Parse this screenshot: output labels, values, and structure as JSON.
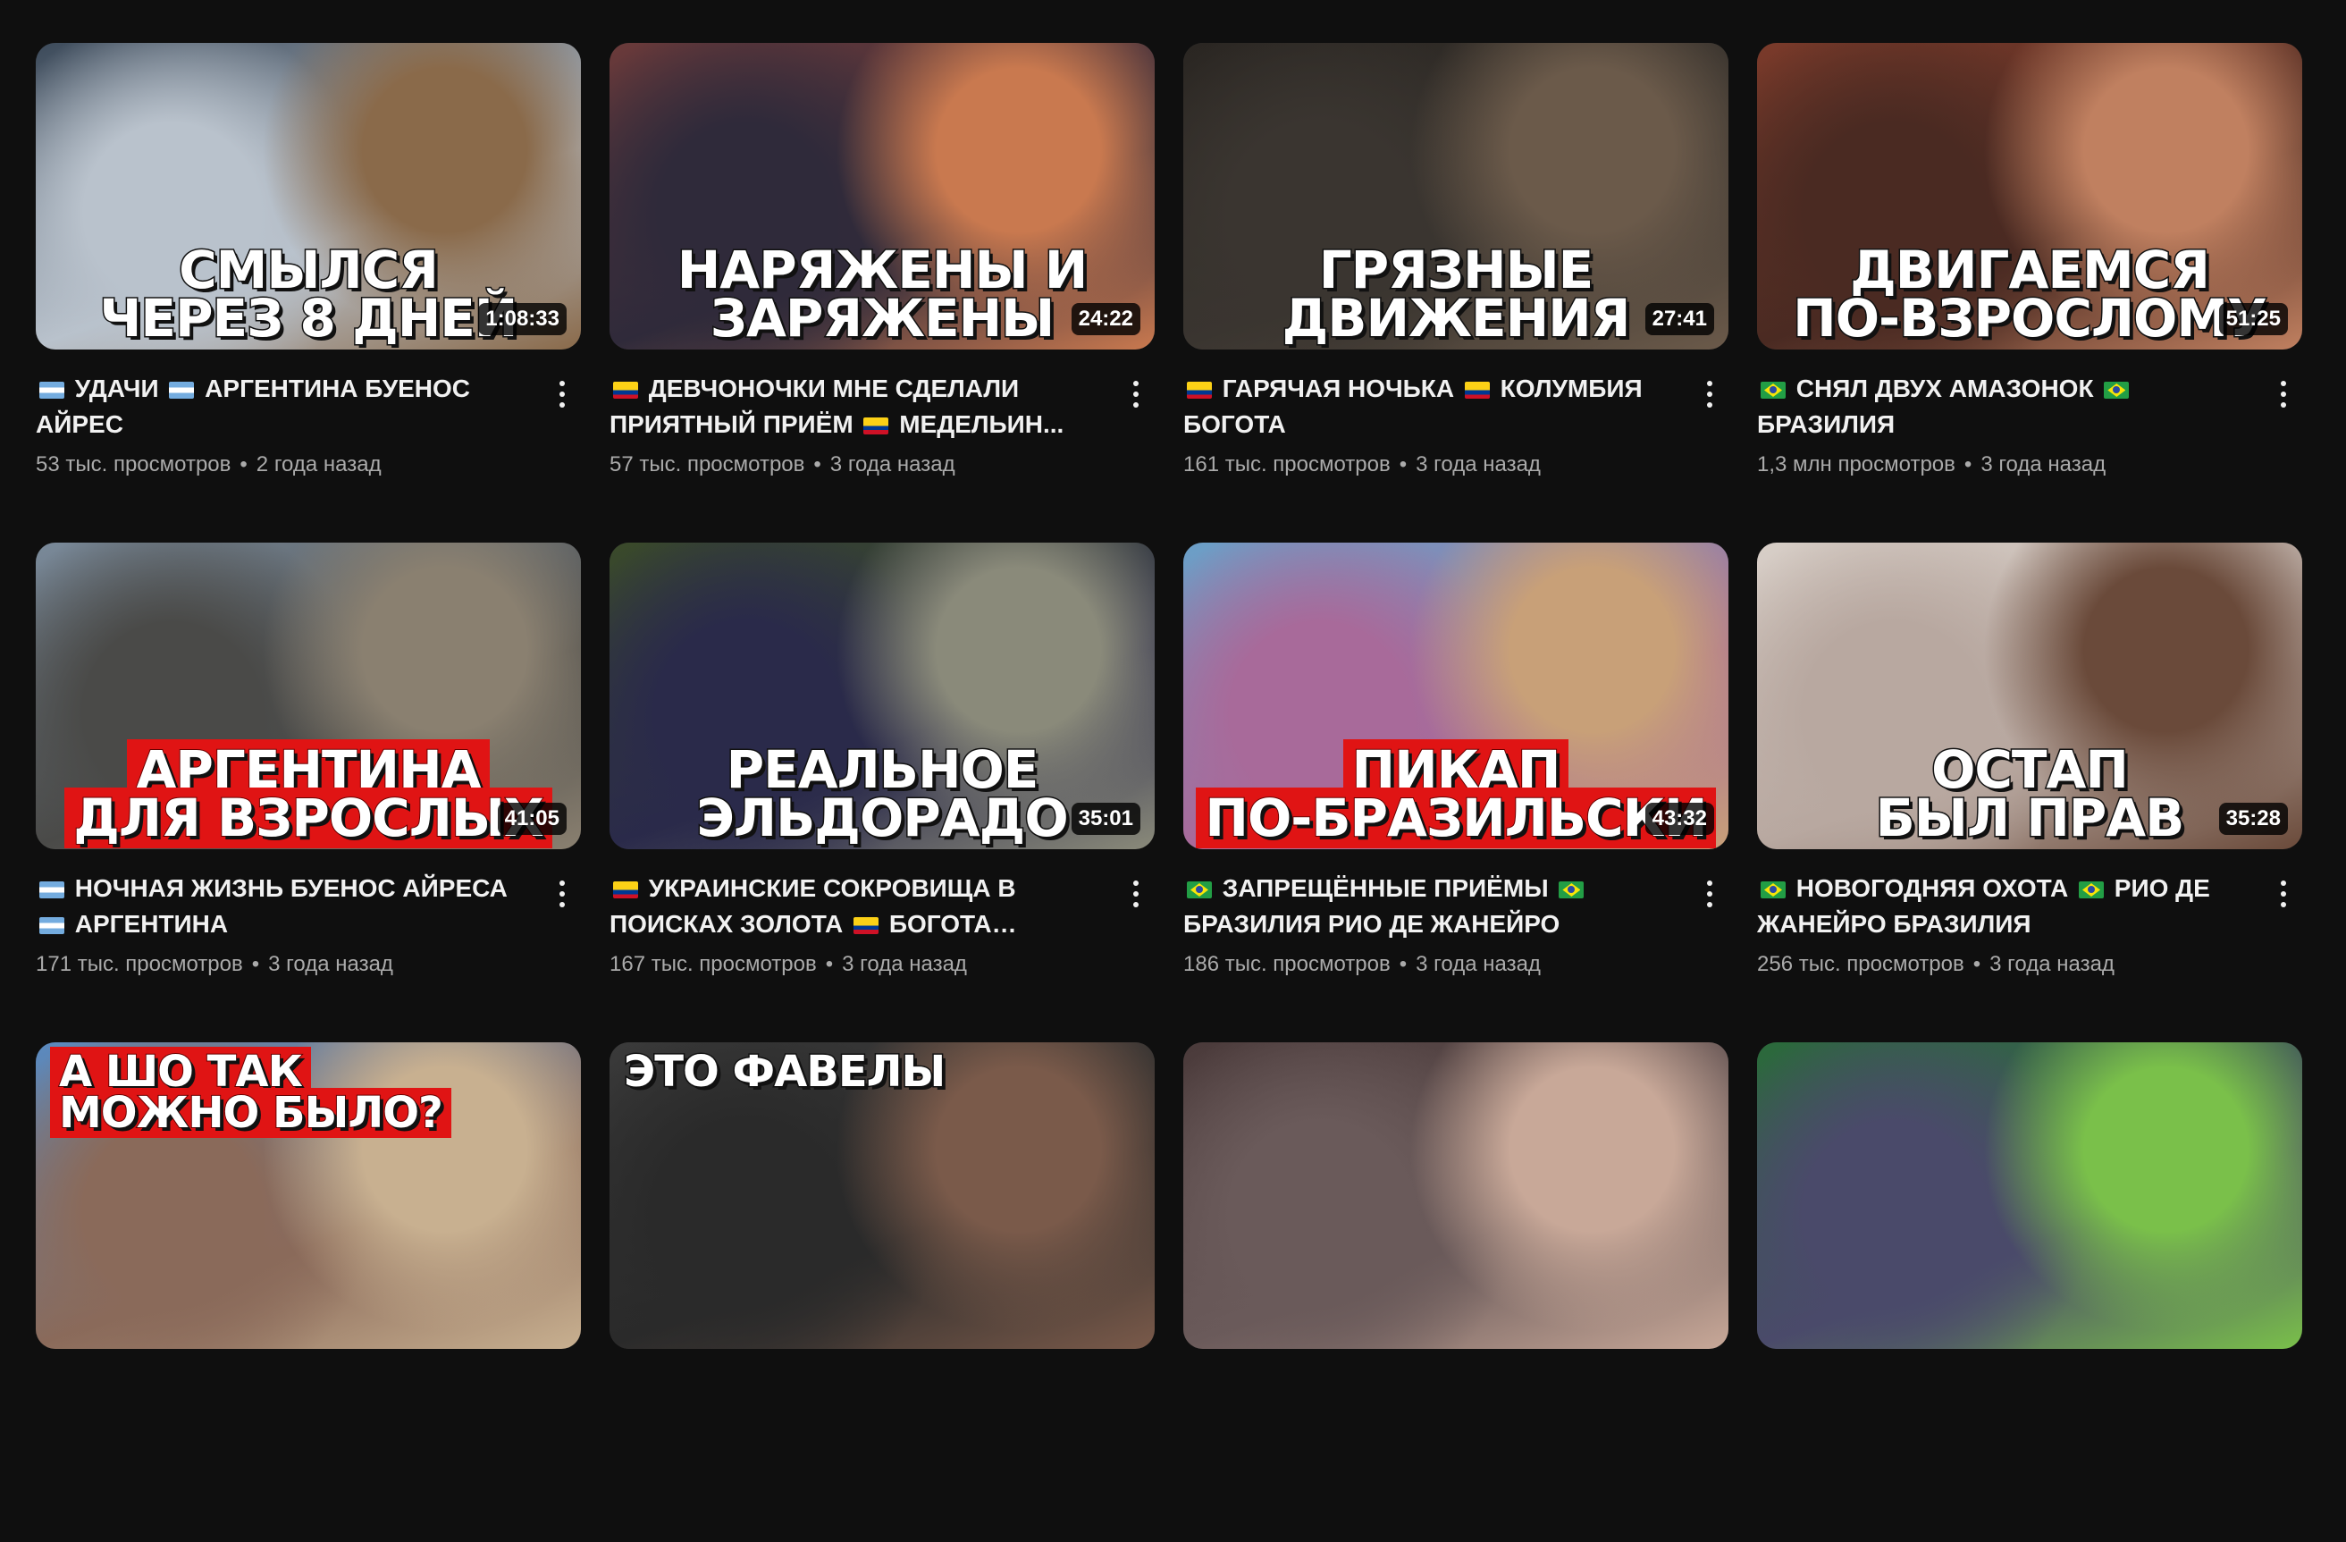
{
  "videos": [
    {
      "overlay": [
        "СМЫЛСЯ",
        "ЧЕРЕЗ 8 ДНЕЙ"
      ],
      "duration": "1:08:33",
      "flag": "ar",
      "title_a": "УДАЧИ",
      "title_b": "АРГЕНТИНА БУЕНОС АЙРЕС",
      "views": "53 тыс. просмотров",
      "age": "2 года назад",
      "colors": [
        "#3c4a5a",
        "#8a6a4a",
        "#b9c2cc"
      ]
    },
    {
      "overlay": [
        "НАРЯЖЕНЫ И",
        "ЗАРЯЖЕНЫ"
      ],
      "duration": "24:22",
      "flag": "co",
      "title_a": "ДЕВЧОНОЧКИ МНЕ СДЕЛАЛИ ПРИЯТНЫЙ ПРИЁМ",
      "title_b": "МЕДЕЛЬИН...",
      "views": "57 тыс. просмотров",
      "age": "3 года назад",
      "colors": [
        "#6a3a3a",
        "#c9794f",
        "#2f2a3a"
      ]
    },
    {
      "overlay": [
        "ГРЯЗНЫЕ",
        "ДВИЖЕНИЯ"
      ],
      "duration": "27:41",
      "flag": "co",
      "title_a": "ГАРЯЧАЯ НОЧЬКА",
      "title_b": "КОЛУМБИЯ БОГОТА",
      "views": "161 тыс. просмотров",
      "age": "3 года назад",
      "colors": [
        "#2a2622",
        "#6b5a4a",
        "#3a3530"
      ]
    },
    {
      "overlay": [
        "ДВИГАЕМСЯ",
        "ПО-ВЗРОСЛОМУ"
      ],
      "duration": "51:25",
      "flag": "br",
      "title_a": "СНЯЛ ДВУХ АМАЗОНОК",
      "title_b": "БРАЗИЛИЯ",
      "views": "1,3 млн просмотров",
      "age": "3 года назад",
      "colors": [
        "#7a3a2a",
        "#c08060",
        "#4a2a22"
      ]
    },
    {
      "overlay": [
        "АРГЕНТИНА",
        "ДЛЯ ВЗРОСЛЫХ"
      ],
      "duration": "41:05",
      "flag": "ar",
      "title_a": "НОЧНАЯ ЖИЗНЬ БУЕНОС АЙРЕСА",
      "title_b": "АРГЕНТИНА",
      "views": "171 тыс. просмотров",
      "age": "3 года назад",
      "colors": [
        "#7a8a9a",
        "#8a8070",
        "#4a4a48"
      ]
    },
    {
      "overlay": [
        "РЕАЛЬНОЕ",
        "ЭЛЬДОРАДО"
      ],
      "duration": "35:01",
      "flag": "co",
      "title_a": "УКРАИНСКИЕ СОКРОВИЩА В ПОИСКАХ ЗОЛОТА",
      "title_b": "БОГОТА КОЛУМБИЯ",
      "views": "167 тыс. просмотров",
      "age": "3 года назад",
      "colors": [
        "#3a4a2a",
        "#8a8a7a",
        "#2a2a4a"
      ]
    },
    {
      "overlay": [
        "ПИКАП",
        "ПО-БРАЗИЛЬСКИ"
      ],
      "duration": "43:32",
      "flag": "br",
      "title_a": "ЗАПРЕЩЁННЫЕ ПРИЁМЫ",
      "title_b": "БРАЗИЛИЯ РИО ДЕ ЖАНЕЙРО",
      "views": "186 тыс. просмотров",
      "age": "3 года назад",
      "colors": [
        "#6aa0c8",
        "#c8a078",
        "#a86a9a"
      ]
    },
    {
      "overlay": [
        "ОСТАП",
        "БЫЛ ПРАВ"
      ],
      "duration": "35:28",
      "flag": "br",
      "title_a": "НОВОГОДНЯЯ ОХОТА",
      "title_b": "РИО ДЕ ЖАНЕЙРО БРАЗИЛИЯ",
      "views": "256 тыс. просмотров",
      "age": "3 года назад",
      "colors": [
        "#d8cfc8",
        "#6a4a3a",
        "#b8a8a0"
      ]
    },
    {
      "overlay": [
        "А ШО ТАК",
        "МОЖНО БЫЛО?"
      ],
      "duration": "",
      "flag": "",
      "title_a": "",
      "title_b": "",
      "views": "",
      "age": "",
      "colors": [
        "#5a8ac0",
        "#c8b090",
        "#8a6a5a"
      ]
    },
    {
      "overlay": [
        "",
        "ЭТО ФАВЕЛЫ"
      ],
      "duration": "",
      "flag": "",
      "title_a": "",
      "title_b": "",
      "views": "",
      "age": "",
      "colors": [
        "#3a3a3a",
        "#7a5a4a",
        "#2a2a2a"
      ]
    },
    {
      "overlay": [
        "",
        ""
      ],
      "duration": "",
      "flag": "",
      "title_a": "",
      "title_b": "",
      "views": "",
      "age": "",
      "colors": [
        "#4a3a3a",
        "#c8a898",
        "#6a5a5a"
      ]
    },
    {
      "overlay": [
        "",
        ""
      ],
      "duration": "",
      "flag": "",
      "title_a": "",
      "title_b": "",
      "views": "",
      "age": "",
      "colors": [
        "#2a6a3a",
        "#7ac04a",
        "#4a4a6a"
      ]
    }
  ]
}
